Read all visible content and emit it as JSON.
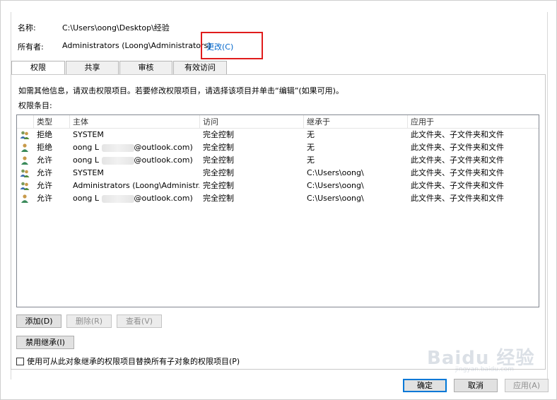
{
  "fields": {
    "name_label": "名称:",
    "name_value": "C:\\Users\\oong\\Desktop\\经验",
    "owner_label": "所有者:",
    "owner_value": "Administrators (Loong\\Administrators)",
    "change_link": "更改(C)"
  },
  "tabs": [
    {
      "label": "权限",
      "active": true
    },
    {
      "label": "共享",
      "active": false
    },
    {
      "label": "审核",
      "active": false
    },
    {
      "label": "有效访问",
      "active": false
    }
  ],
  "info_text": "如需其他信息，请双击权限项目。若要修改权限项目，请选择该项目并单击“编辑”(如果可用)。",
  "entries_label": "权限条目:",
  "table": {
    "columns": [
      "类型",
      "主体",
      "访问",
      "继承于",
      "应用于"
    ],
    "rows": [
      {
        "icon": "group-icon",
        "type": "拒绝",
        "principal_prefix": "SYSTEM",
        "principal_suffix": "",
        "access": "完全控制",
        "inherit": "无",
        "applies": "此文件夹、子文件夹和文件"
      },
      {
        "icon": "user-icon",
        "type": "拒绝",
        "principal_prefix": "oong L",
        "principal_suffix": "@outlook.com)",
        "access": "完全控制",
        "inherit": "无",
        "applies": "此文件夹、子文件夹和文件"
      },
      {
        "icon": "user-icon",
        "type": "允许",
        "principal_prefix": "oong L",
        "principal_suffix": "@outlook.com)",
        "access": "完全控制",
        "inherit": "无",
        "applies": "此文件夹、子文件夹和文件"
      },
      {
        "icon": "group-icon",
        "type": "允许",
        "principal_prefix": "SYSTEM",
        "principal_suffix": "",
        "access": "完全控制",
        "inherit": "C:\\Users\\oong\\",
        "applies": "此文件夹、子文件夹和文件"
      },
      {
        "icon": "group-icon",
        "type": "允许",
        "principal_prefix": "Administrators (Loong\\Administr...",
        "principal_suffix": "",
        "access": "完全控制",
        "inherit": "C:\\Users\\oong\\",
        "applies": "此文件夹、子文件夹和文件"
      },
      {
        "icon": "user-icon",
        "type": "允许",
        "principal_prefix": "oong L",
        "principal_suffix": "@outlook.com)",
        "access": "完全控制",
        "inherit": "C:\\Users\\oong\\",
        "applies": "此文件夹、子文件夹和文件"
      }
    ]
  },
  "buttons": {
    "add": "添加(D)",
    "remove": "删除(R)",
    "view": "查看(V)",
    "disable_inherit": "禁用继承(I)",
    "ok": "确定",
    "cancel": "取消",
    "apply": "应用(A)"
  },
  "checkbox_label": "使用可从此对象继承的权限项目替换所有子对象的权限项目(P)",
  "watermark": {
    "main": "Baidu 经验",
    "sub": "jingyan.baidu.com"
  },
  "colors": {
    "link": "#0066cc",
    "highlight": "#e01c1c",
    "default_button": "#0078d7"
  }
}
